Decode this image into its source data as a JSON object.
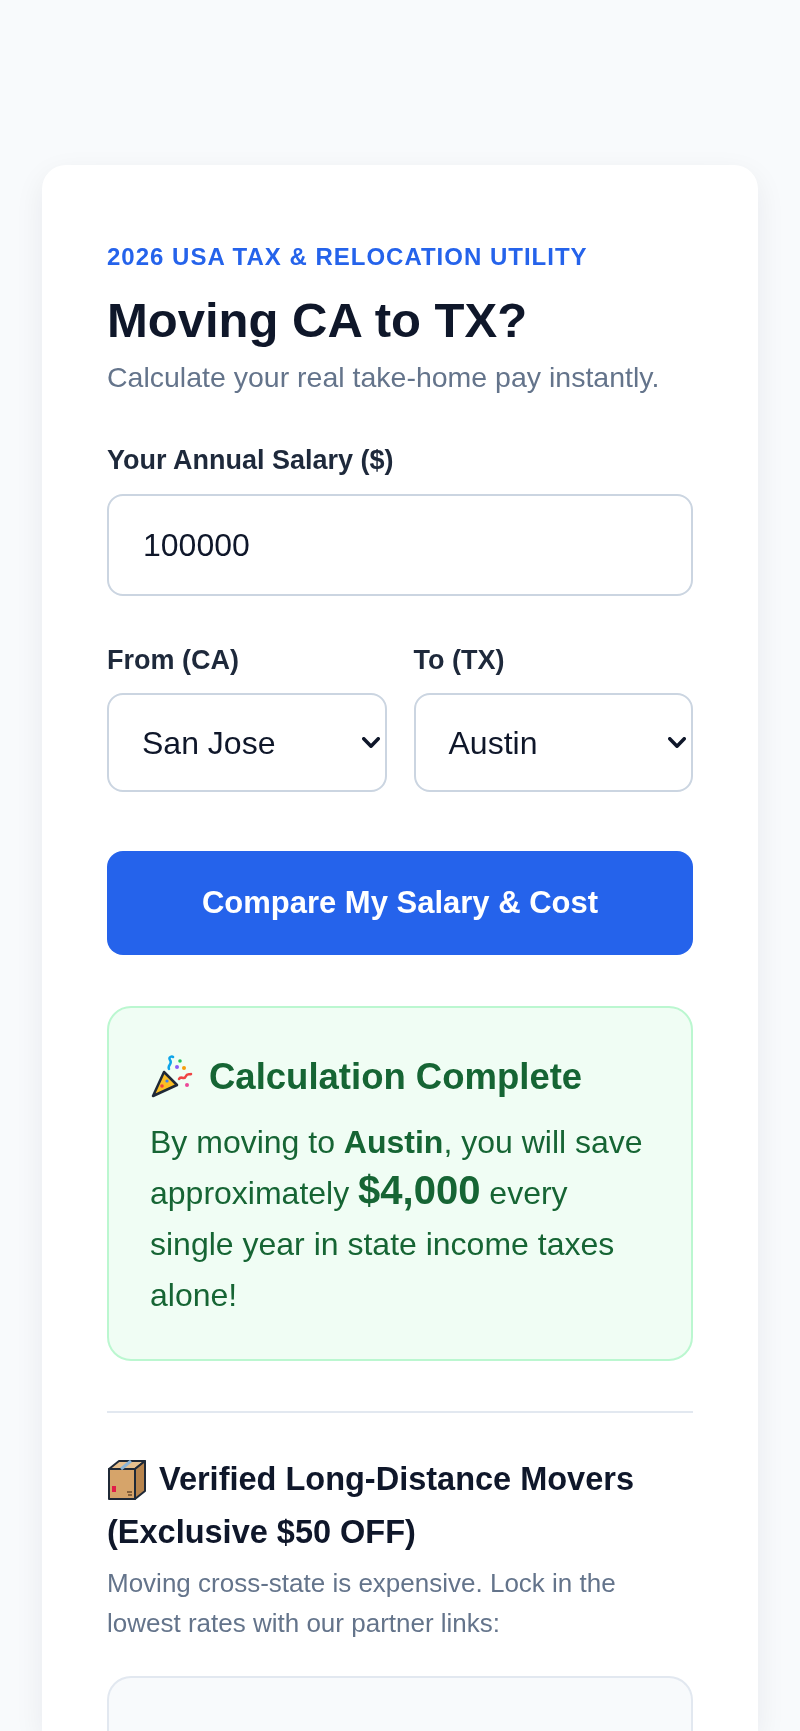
{
  "header": {
    "eyebrow": "2026 USA TAX & RELOCATION UTILITY",
    "title": "Moving CA to TX?",
    "subtitle": "Calculate your real take-home pay instantly."
  },
  "form": {
    "salary": {
      "label": "Your Annual Salary ($)",
      "value": "100000"
    },
    "from": {
      "label": "From (CA)",
      "value": "San Jose"
    },
    "to": {
      "label": "To (TX)",
      "value": "Austin"
    },
    "submit": "Compare My Salary & Cost"
  },
  "result": {
    "title": "Calculation Complete",
    "message": [
      {
        "kind": "plain",
        "text": "By moving to "
      },
      {
        "kind": "bold",
        "text": "Austin"
      },
      {
        "kind": "plain",
        "text": ", you will save approximately "
      },
      {
        "kind": "amount",
        "text": "$4,000"
      },
      {
        "kind": "plain",
        "text": " every single year in state income taxes alone!"
      }
    ]
  },
  "movers": {
    "title": "Verified Long-Distance Movers",
    "offer": "(Exclusive $50 OFF)",
    "description": "Moving cross-state is expensive. Lock in the lowest rates with our partner links:"
  }
}
